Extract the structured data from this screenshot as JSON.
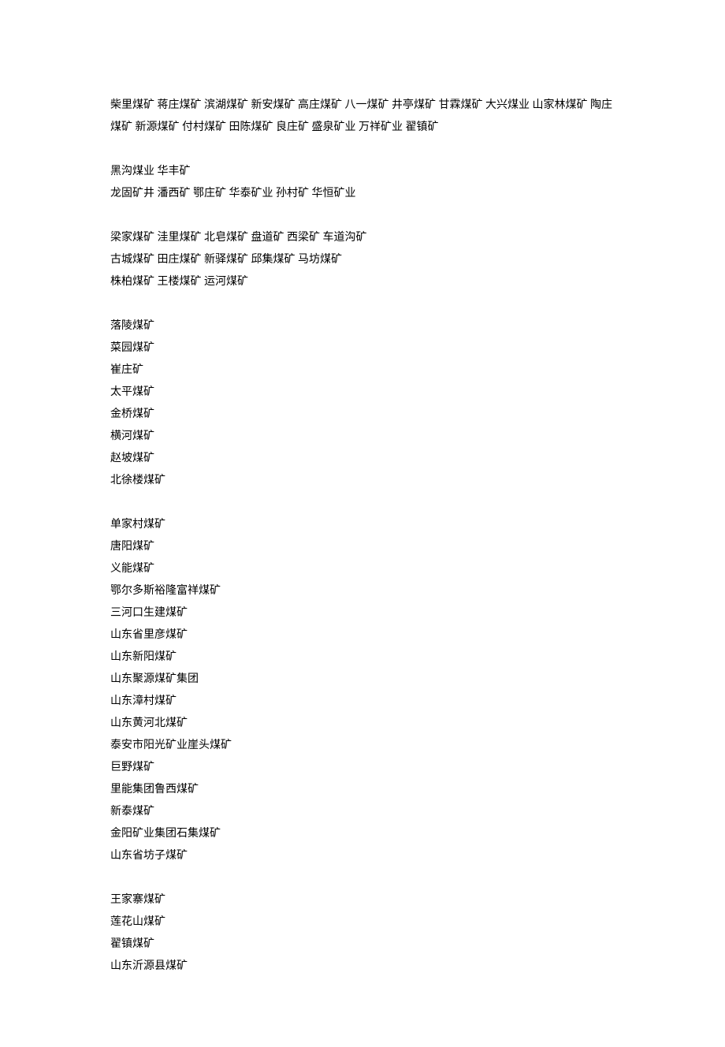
{
  "blocks": [
    {
      "lines": [
        "柴里煤矿  蒋庄煤矿  滨湖煤矿  新安煤矿  高庄煤矿  八一煤矿  井亭煤矿  甘霖煤矿  大兴煤业  山家林煤矿  陶庄煤矿  新源煤矿  付村煤矿  田陈煤矿  良庄矿  盛泉矿业  万祥矿业  翟镇矿"
      ]
    },
    {
      "lines": [
        "黑沟煤业  华丰矿",
        "龙固矿井  潘西矿  鄂庄矿  华泰矿业  孙村矿  华恒矿业"
      ]
    },
    {
      "lines": [
        "梁家煤矿  洼里煤矿  北皂煤矿  盘道矿  西梁矿  车道沟矿",
        "古城煤矿  田庄煤矿  新驿煤矿  邱集煤矿  马坊煤矿",
        "株柏煤矿  王楼煤矿  运河煤矿"
      ]
    },
    {
      "lines": [
        "落陵煤矿",
        "菜园煤矿",
        "崔庄矿",
        "太平煤矿",
        "金桥煤矿",
        "横河煤矿",
        "赵坡煤矿",
        "北徐楼煤矿"
      ]
    },
    {
      "lines": [
        "单家村煤矿",
        "唐阳煤矿",
        "义能煤矿",
        "鄂尔多斯裕隆富祥煤矿",
        "三河口生建煤矿",
        "山东省里彦煤矿",
        "山东新阳煤矿",
        "山东聚源煤矿集团",
        "山东漳村煤矿",
        "山东黄河北煤矿",
        "泰安市阳光矿业崖头煤矿",
        "巨野煤矿",
        "里能集团鲁西煤矿",
        "新泰煤矿",
        "金阳矿业集团石集煤矿",
        "山东省坊子煤矿"
      ]
    },
    {
      "lines": [
        "王家寨煤矿",
        "莲花山煤矿",
        "翟镇煤矿",
        "山东沂源县煤矿"
      ]
    }
  ]
}
